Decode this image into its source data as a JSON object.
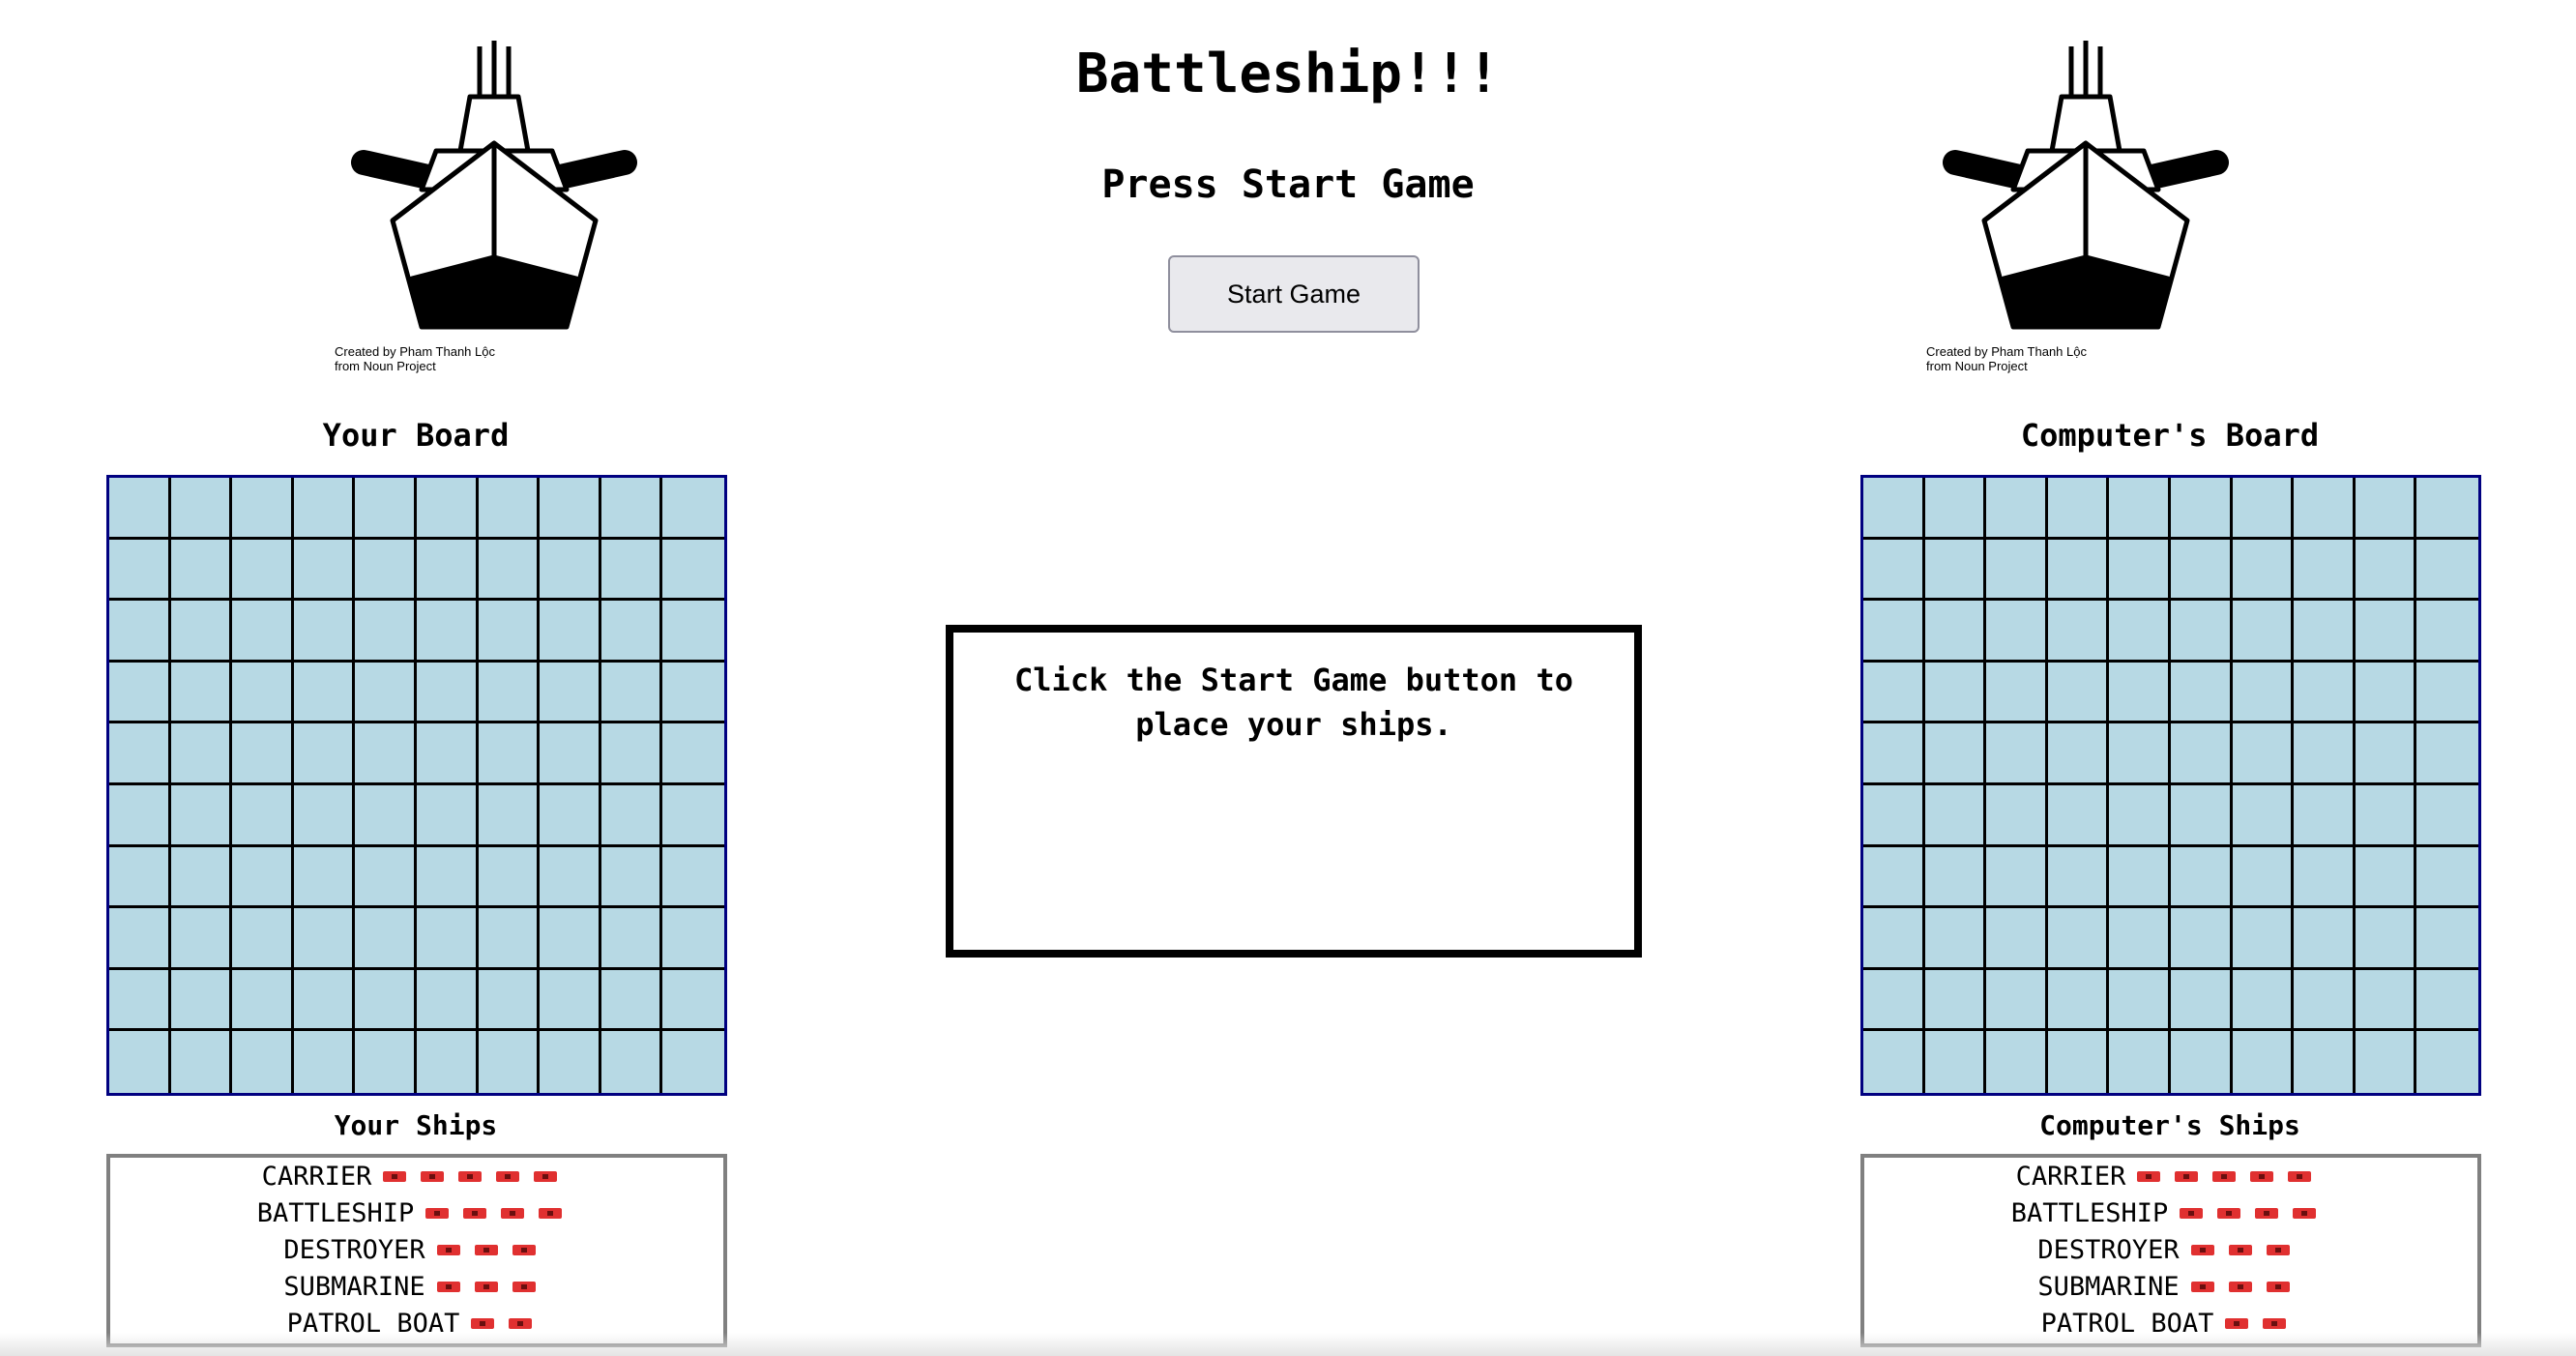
{
  "header": {
    "title": "Battleship!!!",
    "status": "Press Start Game",
    "start_button_label": "Start Game"
  },
  "credits": {
    "left": {
      "created_by": "Created by",
      "author": "Pham Thanh Lộc",
      "source": "from Noun Project"
    },
    "right": {
      "created_by": "Created by",
      "author": "Pham Thanh Lộc",
      "source": "from Noun Project"
    }
  },
  "player": {
    "board_title": "Your Board",
    "ships_title": "Your Ships",
    "ships": [
      {
        "name": "CARRIER",
        "size": 5
      },
      {
        "name": "BATTLESHIP",
        "size": 4
      },
      {
        "name": "DESTROYER",
        "size": 3
      },
      {
        "name": "SUBMARINE",
        "size": 3
      },
      {
        "name": "PATROL BOAT",
        "size": 2
      }
    ]
  },
  "computer": {
    "board_title": "Computer's Board",
    "ships_title": "Computer's Ships",
    "ships": [
      {
        "name": "CARRIER",
        "size": 5
      },
      {
        "name": "BATTLESHIP",
        "size": 4
      },
      {
        "name": "DESTROYER",
        "size": 3
      },
      {
        "name": "SUBMARINE",
        "size": 3
      },
      {
        "name": "PATROL BOAT",
        "size": 2
      }
    ]
  },
  "board": {
    "rows": 10,
    "cols": 10
  },
  "message": "Click the Start Game button to place your ships.",
  "colors": {
    "water": "#b7d9e4",
    "board_border": "#000080",
    "ship_peg": "#e03030",
    "button_bg": "#e9e9ed"
  },
  "icons": {
    "logo": "battleship-icon"
  }
}
